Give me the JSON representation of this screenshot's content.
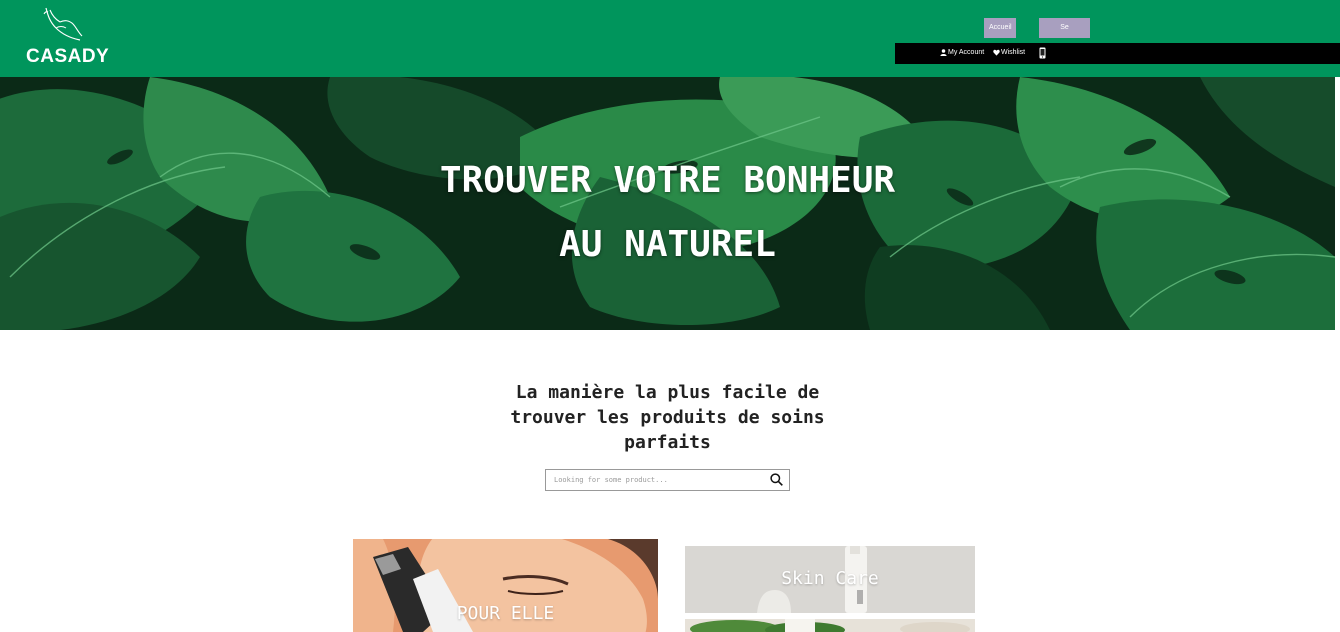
{
  "header": {
    "logo_text": "CASADY",
    "nav": {
      "home_label": "Accueil",
      "login_label": "Se Connecter"
    },
    "account_bar": {
      "my_account_label": "My Account",
      "wishlist_label": "Wishlist"
    }
  },
  "hero": {
    "title_line1": "TROUVER VOTRE BONHEUR",
    "title_line2": "AU NATUREL"
  },
  "search_section": {
    "tagline_line1": "La manière la plus facile de",
    "tagline_line2": "trouver les produits de soins",
    "tagline_line3": "parfaits",
    "search_placeholder": "Looking for some product..."
  },
  "categories": [
    {
      "label": "POUR ELLE"
    },
    {
      "label": "Skin Care"
    }
  ],
  "icons": {
    "logo": "hand-logo-icon",
    "account": "user-icon",
    "wishlist": "heart-icon",
    "phone": "phone-icon",
    "search": "search-icon"
  },
  "colors": {
    "header_green": "#00955c",
    "nav_button": "#a89fbf",
    "account_bar": "#000000"
  }
}
